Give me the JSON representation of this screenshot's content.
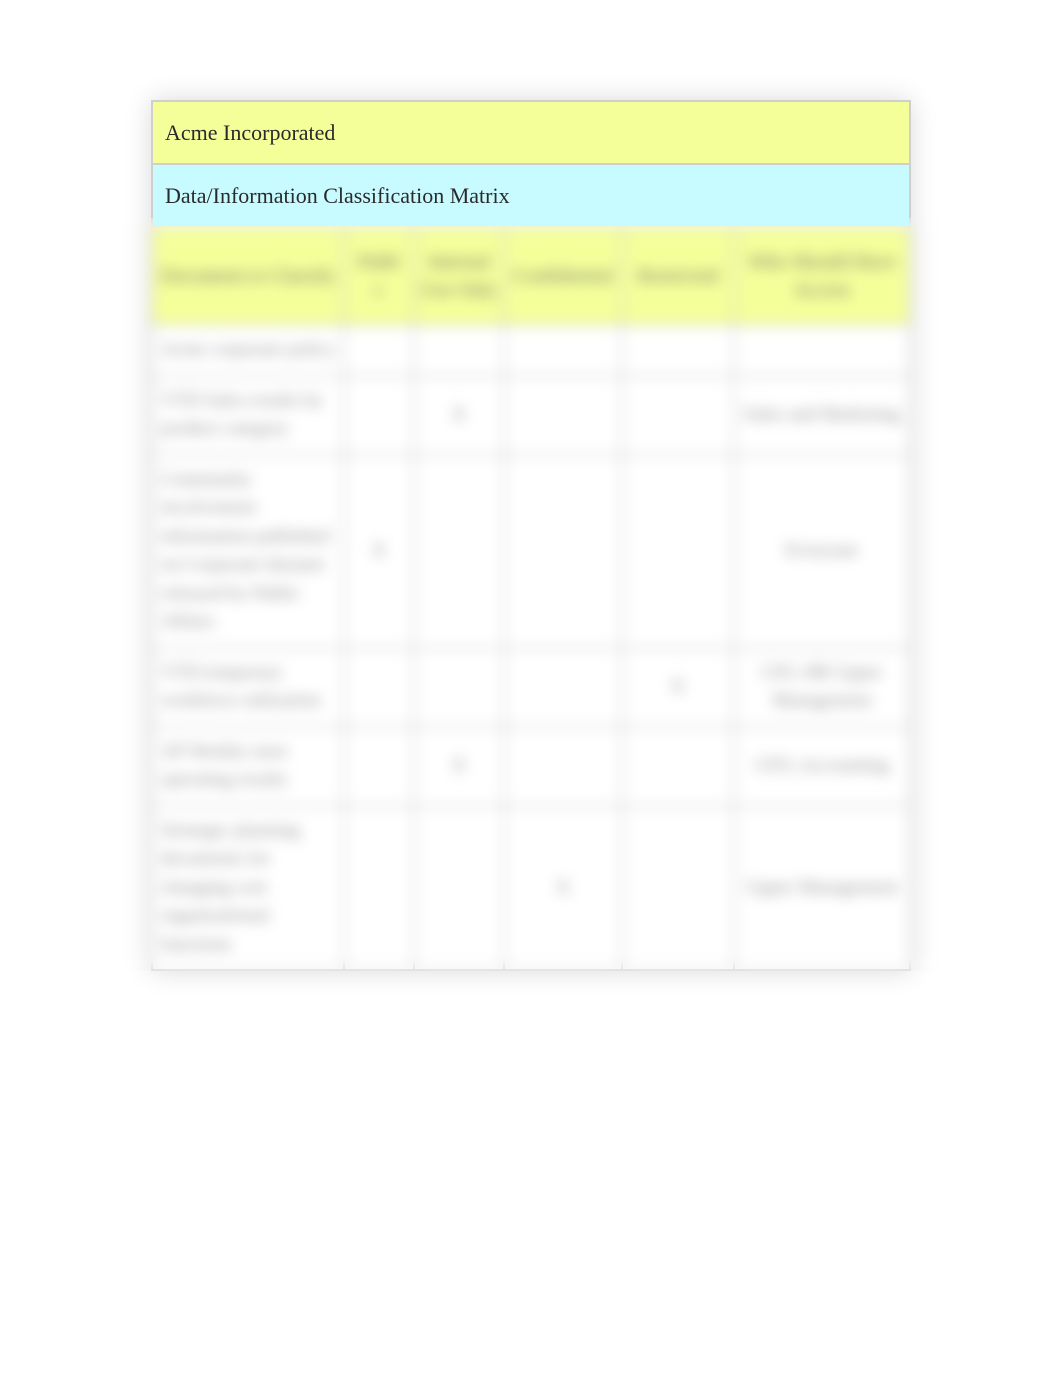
{
  "title": "Acme Incorporated",
  "subtitle": "Data/Information Classification Matrix",
  "headers": {
    "doc": "Document to Classify",
    "public": "Publi\nc",
    "internal": "Internal Use Only",
    "confidential": "Confidential",
    "restricted": "Restricted",
    "access": "Who Should Have Access"
  },
  "rows": [
    {
      "doc": "Acme corporate policy",
      "public": "",
      "internal": "",
      "confidential": "",
      "restricted": "",
      "access": ""
    },
    {
      "doc": "YTD Sales results by product category",
      "public": "",
      "internal": "X",
      "confidential": "",
      "restricted": "",
      "access": "Sales and Marketing"
    },
    {
      "doc": "Community involvement information published on Corporate Intranet released by Public Affairs",
      "public": "X",
      "internal": "",
      "confidential": "",
      "restricted": "",
      "access": "Everyone"
    },
    {
      "doc": "YTD temporary workforce utilization",
      "public": "",
      "internal": "",
      "confidential": "",
      "restricted": "X",
      "access": "CIO, HR Upper Management"
    },
    {
      "doc": "AP Weekly store operating results",
      "public": "",
      "internal": "X",
      "confidential": "",
      "restricted": "",
      "access": "CFO, Accounting"
    },
    {
      "doc": "Strategic planning documents for changing core organizational functions",
      "public": "",
      "internal": "",
      "confidential": "X",
      "restricted": "",
      "access": "Upper Management"
    }
  ]
}
